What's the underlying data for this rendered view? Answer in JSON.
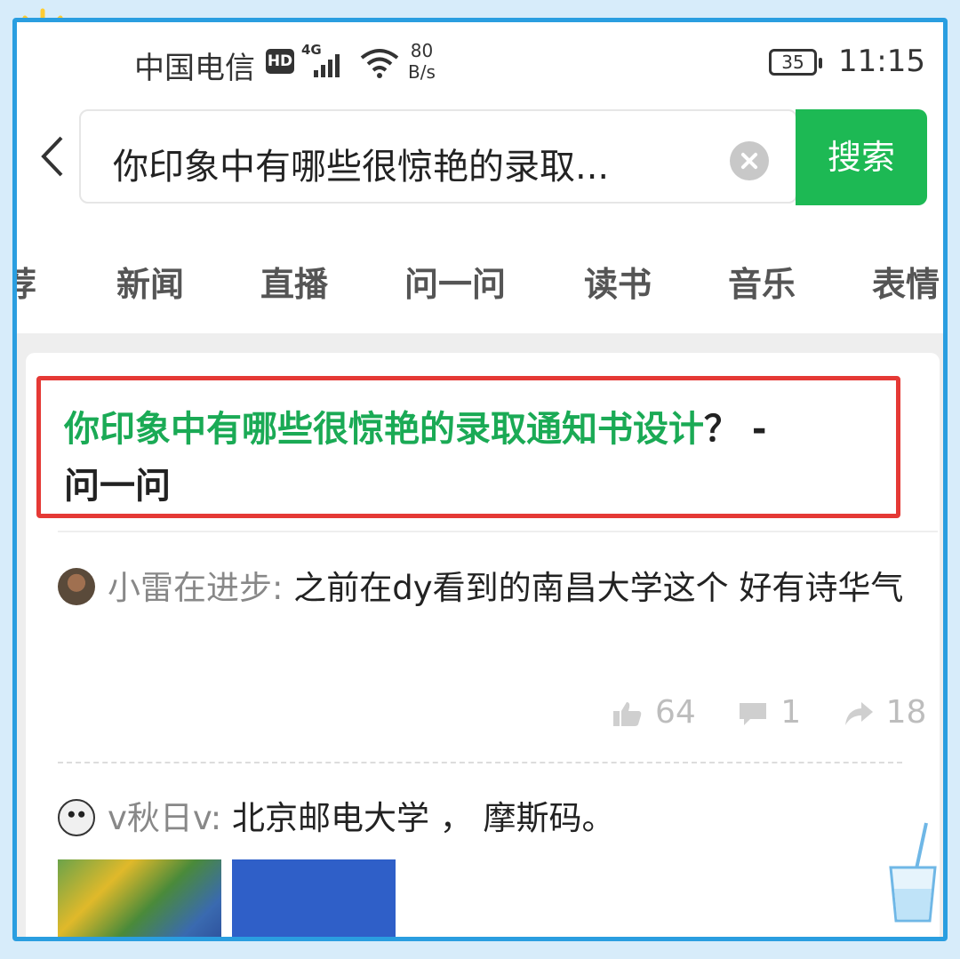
{
  "status_bar": {
    "carrier": "中国电信",
    "hd_badge": "HD",
    "network": "4G",
    "speed_value": "80",
    "speed_unit": "B/s",
    "battery": "35",
    "time": "11:15"
  },
  "search": {
    "query": "你印象中有哪些很惊艳的录取...",
    "button_label": "搜索"
  },
  "tabs": [
    {
      "label": "荐"
    },
    {
      "label": "新闻"
    },
    {
      "label": "直播"
    },
    {
      "label": "问一问"
    },
    {
      "label": "读书"
    },
    {
      "label": "音乐"
    },
    {
      "label": "表情"
    }
  ],
  "result": {
    "title_highlight": "你印象中有哪些很惊艳的录取通知书设计",
    "title_suffix": "？ -",
    "title_source": "问一问"
  },
  "posts": [
    {
      "user": "小雷在进步:",
      "content": "之前在dy看到的南昌大学这个 好有诗华气",
      "likes": "64",
      "comments": "1",
      "shares": "18"
    },
    {
      "user": "v秋日v:",
      "content": "北京邮电大学 ， 摩斯码。"
    }
  ],
  "colors": {
    "accent_green": "#1db954",
    "title_green": "#1aaa55",
    "highlight_red": "#e53935",
    "frame_blue": "#2a9ee0"
  }
}
